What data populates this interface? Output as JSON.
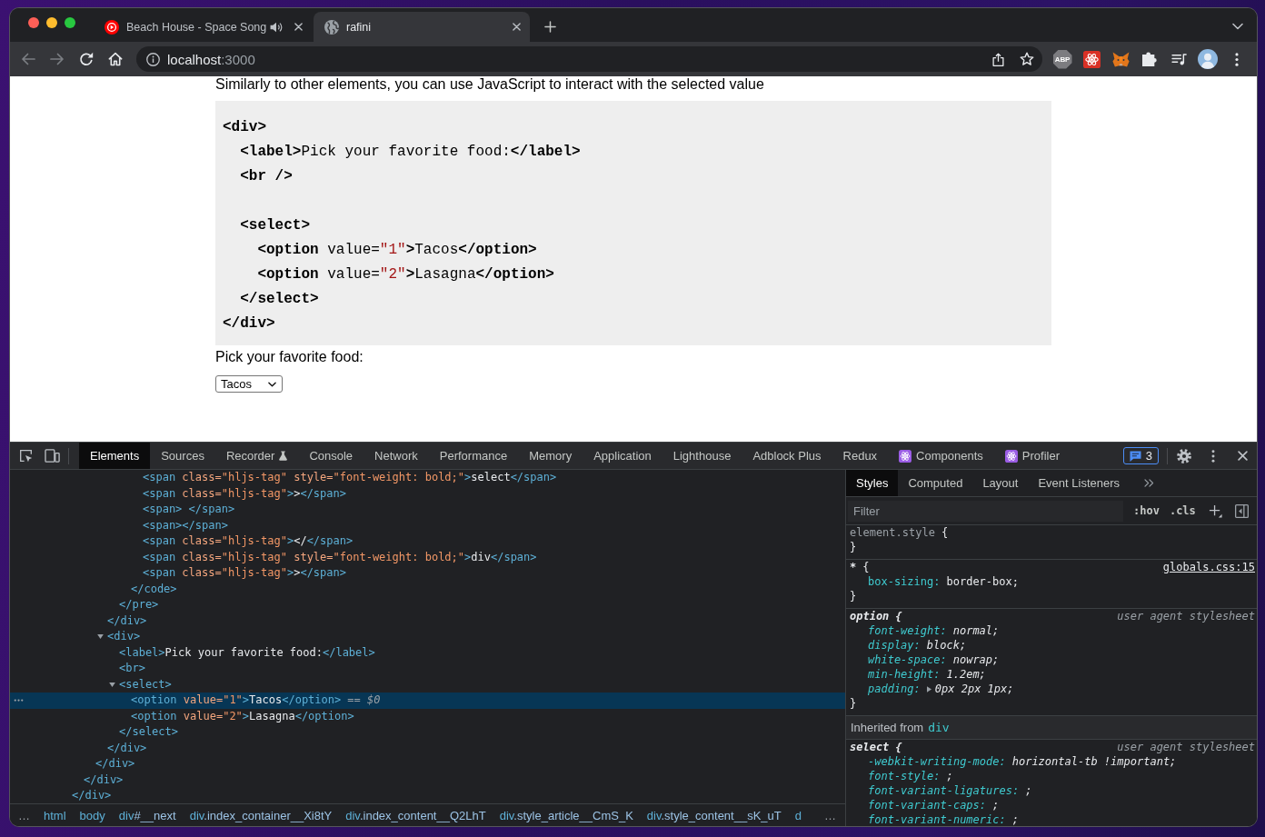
{
  "browser": {
    "tabs": [
      {
        "title": "Beach House - Space Song",
        "selected": false,
        "audio": true
      },
      {
        "title": "rafini",
        "selected": true,
        "audio": false
      }
    ],
    "toolbar": {
      "back_disabled": true,
      "forward_disabled": true,
      "host": "localhost",
      "port": ":3000",
      "extension_label": "ABP"
    }
  },
  "page": {
    "intro": "Similarly to other elements, you can use JavaScript to interact with the selected value",
    "code_lines": [
      {
        "kind": "code",
        "tokens": [
          {
            "kind": "tag",
            "text": "<div>"
          }
        ]
      },
      {
        "kind": "code",
        "tokens": [
          {
            "kind": "tag",
            "text": "  <label>"
          },
          {
            "kind": "text",
            "text": "Pick your favorite food:"
          },
          {
            "kind": "tag",
            "text": "</label>"
          }
        ]
      },
      {
        "kind": "code",
        "tokens": [
          {
            "kind": "tag",
            "text": "  <br />"
          }
        ]
      },
      {
        "kind": "blank"
      },
      {
        "kind": "code",
        "tokens": [
          {
            "kind": "tag",
            "text": "  <select>"
          }
        ]
      },
      {
        "kind": "code",
        "tokens": [
          {
            "kind": "tag",
            "text": "    <option"
          },
          {
            "kind": "attr",
            "text": " value="
          },
          {
            "kind": "string",
            "text": "\"1\""
          },
          {
            "kind": "tag",
            "text": ">"
          },
          {
            "kind": "text",
            "text": "Tacos"
          },
          {
            "kind": "tag",
            "text": "</option>"
          }
        ]
      },
      {
        "kind": "code",
        "tokens": [
          {
            "kind": "tag",
            "text": "    <option"
          },
          {
            "kind": "attr",
            "text": " value="
          },
          {
            "kind": "string",
            "text": "\"2\""
          },
          {
            "kind": "tag",
            "text": ">"
          },
          {
            "kind": "text",
            "text": "Lasagna"
          },
          {
            "kind": "tag",
            "text": "</option>"
          }
        ]
      },
      {
        "kind": "code",
        "tokens": [
          {
            "kind": "tag",
            "text": "  </select>"
          }
        ]
      },
      {
        "kind": "code",
        "tokens": [
          {
            "kind": "tag",
            "text": "</div>"
          }
        ]
      }
    ],
    "label": "Pick your favorite food:",
    "select_value": "Tacos"
  },
  "devtools": {
    "tabs": [
      {
        "label": "Elements",
        "selected": true,
        "kind": "plain"
      },
      {
        "label": "Sources",
        "selected": false,
        "kind": "plain"
      },
      {
        "label": "Recorder",
        "selected": false,
        "kind": "experimental"
      },
      {
        "label": "Console",
        "selected": false,
        "kind": "plain"
      },
      {
        "label": "Network",
        "selected": false,
        "kind": "plain"
      },
      {
        "label": "Performance",
        "selected": false,
        "kind": "plain"
      },
      {
        "label": "Memory",
        "selected": false,
        "kind": "plain"
      },
      {
        "label": "Application",
        "selected": false,
        "kind": "plain"
      },
      {
        "label": "Lighthouse",
        "selected": false,
        "kind": "plain"
      },
      {
        "label": "Adblock Plus",
        "selected": false,
        "kind": "plain"
      },
      {
        "label": "Redux",
        "selected": false,
        "kind": "plain"
      },
      {
        "label": "Components",
        "selected": false,
        "kind": "extension"
      },
      {
        "label": "Profiler",
        "selected": false,
        "kind": "extension"
      }
    ],
    "issues_count": "3",
    "elements": {
      "tree": [
        {
          "selected": false,
          "close": [
            {
              "kind": "tag",
              "text": "</div>"
            }
          ],
          "children": [
            {
              "selected": false,
              "close": [
                {
                  "kind": "tag",
                  "text": "</div>"
                }
              ],
              "children": [
                {
                  "selected": false,
                  "close": [
                    {
                      "kind": "tag",
                      "text": "</div>"
                    }
                  ],
                  "children": [
                    {
                      "selected": false,
                      "close": [
                        {
                          "kind": "tag",
                          "text": "</div>"
                        }
                      ],
                      "children": [
                        {
                          "selected": false,
                          "close": [
                            {
                              "kind": "tag",
                              "text": "</pre>"
                            }
                          ],
                          "children": [
                            {
                              "selected": false,
                              "close": [
                                {
                                  "kind": "tag",
                                  "text": "</code>"
                                }
                              ],
                              "children": [
                                {
                                  "selected": false,
                                  "open": [
                                    {
                                      "kind": "tag",
                                      "text": "<span"
                                    },
                                    {
                                      "kind": "attr",
                                      "text": " class="
                                    },
                                    {
                                      "kind": "value",
                                      "text": "\"hljs-tag\""
                                    },
                                    {
                                      "kind": "attr",
                                      "text": " style="
                                    },
                                    {
                                      "kind": "value",
                                      "text": "\"font-weight: bold;\""
                                    },
                                    {
                                      "kind": "tag",
                                      "text": ">"
                                    },
                                    {
                                      "kind": "text",
                                      "text": "select"
                                    },
                                    {
                                      "kind": "tag",
                                      "text": "</span>"
                                    }
                                  ]
                                },
                                {
                                  "selected": false,
                                  "open": [
                                    {
                                      "kind": "tag",
                                      "text": "<span"
                                    },
                                    {
                                      "kind": "attr",
                                      "text": " class="
                                    },
                                    {
                                      "kind": "value",
                                      "text": "\"hljs-tag\""
                                    },
                                    {
                                      "kind": "tag",
                                      "text": ">"
                                    },
                                    {
                                      "kind": "text",
                                      "text": ">"
                                    },
                                    {
                                      "kind": "tag",
                                      "text": "</span>"
                                    }
                                  ]
                                },
                                {
                                  "selected": false,
                                  "open": [
                                    {
                                      "kind": "tag",
                                      "text": "<span> </span>"
                                    }
                                  ]
                                },
                                {
                                  "selected": false,
                                  "open": [
                                    {
                                      "kind": "tag",
                                      "text": "<span></span>"
                                    }
                                  ]
                                },
                                {
                                  "selected": false,
                                  "open": [
                                    {
                                      "kind": "tag",
                                      "text": "<span"
                                    },
                                    {
                                      "kind": "attr",
                                      "text": " class="
                                    },
                                    {
                                      "kind": "value",
                                      "text": "\"hljs-tag\""
                                    },
                                    {
                                      "kind": "tag",
                                      "text": ">"
                                    },
                                    {
                                      "kind": "text",
                                      "text": "</"
                                    },
                                    {
                                      "kind": "tag",
                                      "text": "</span>"
                                    }
                                  ]
                                },
                                {
                                  "selected": false,
                                  "open": [
                                    {
                                      "kind": "tag",
                                      "text": "<span"
                                    },
                                    {
                                      "kind": "attr",
                                      "text": " class="
                                    },
                                    {
                                      "kind": "value",
                                      "text": "\"hljs-tag\""
                                    },
                                    {
                                      "kind": "attr",
                                      "text": " style="
                                    },
                                    {
                                      "kind": "value",
                                      "text": "\"font-weight: bold;\""
                                    },
                                    {
                                      "kind": "tag",
                                      "text": ">"
                                    },
                                    {
                                      "kind": "text",
                                      "text": "div"
                                    },
                                    {
                                      "kind": "tag",
                                      "text": "</span>"
                                    }
                                  ]
                                },
                                {
                                  "selected": false,
                                  "open": [
                                    {
                                      "kind": "tag",
                                      "text": "<span"
                                    },
                                    {
                                      "kind": "attr",
                                      "text": " class="
                                    },
                                    {
                                      "kind": "value",
                                      "text": "\"hljs-tag\""
                                    },
                                    {
                                      "kind": "tag",
                                      "text": ">"
                                    },
                                    {
                                      "kind": "text",
                                      "text": ">"
                                    },
                                    {
                                      "kind": "tag",
                                      "text": "</span>"
                                    }
                                  ]
                                }
                              ]
                            }
                          ]
                        }
                      ]
                    },
                    {
                      "selected": false,
                      "expanded": true,
                      "open": [
                        {
                          "kind": "tag",
                          "text": "<div>"
                        }
                      ],
                      "close": [
                        {
                          "kind": "tag",
                          "text": "</div>"
                        }
                      ],
                      "children": [
                        {
                          "selected": false,
                          "open": [
                            {
                              "kind": "tag",
                              "text": "<label>"
                            },
                            {
                              "kind": "text",
                              "text": "Pick your favorite food:"
                            },
                            {
                              "kind": "tag",
                              "text": "</label>"
                            }
                          ]
                        },
                        {
                          "selected": false,
                          "open": [
                            {
                              "kind": "tag",
                              "text": "<br>"
                            }
                          ]
                        },
                        {
                          "selected": false,
                          "expanded": true,
                          "open": [
                            {
                              "kind": "tag",
                              "text": "<select>"
                            }
                          ],
                          "close": [
                            {
                              "kind": "tag",
                              "text": "</select>"
                            }
                          ],
                          "children": [
                            {
                              "selected": true,
                              "hint": "== $0",
                              "open": [
                                {
                                  "kind": "tag",
                                  "text": "<option"
                                },
                                {
                                  "kind": "attr",
                                  "text": " value="
                                },
                                {
                                  "kind": "value",
                                  "text": "\"1\""
                                },
                                {
                                  "kind": "tag",
                                  "text": ">"
                                },
                                {
                                  "kind": "text",
                                  "text": "Tacos"
                                },
                                {
                                  "kind": "tag",
                                  "text": "</option>"
                                }
                              ]
                            },
                            {
                              "selected": false,
                              "open": [
                                {
                                  "kind": "tag",
                                  "text": "<option"
                                },
                                {
                                  "kind": "attr",
                                  "text": " value="
                                },
                                {
                                  "kind": "value",
                                  "text": "\"2\""
                                },
                                {
                                  "kind": "tag",
                                  "text": ">"
                                },
                                {
                                  "kind": "text",
                                  "text": "Lasagna"
                                },
                                {
                                  "kind": "tag",
                                  "text": "</option>"
                                }
                              ]
                            }
                          ]
                        }
                      ]
                    }
                  ]
                }
              ]
            }
          ]
        }
      ],
      "breadcrumbs": [
        {
          "tag": "html"
        },
        {
          "tag": "body"
        },
        {
          "tag": "div",
          "detail": "#__next"
        },
        {
          "tag": "div",
          "detail": ".index_container__Xi8tY"
        },
        {
          "tag": "div",
          "detail": ".index_content__Q2LhT"
        },
        {
          "tag": "div",
          "detail": ".style_article__CmS_K"
        },
        {
          "tag": "div",
          "detail": ".style_content__sK_uT"
        },
        {
          "tag": "d"
        }
      ],
      "overflow_left": "…",
      "overflow_right": "…"
    },
    "styles": {
      "tabs": [
        {
          "label": "Styles",
          "selected": true
        },
        {
          "label": "Computed",
          "selected": false
        },
        {
          "label": "Layout",
          "selected": false
        },
        {
          "label": "Event Listeners",
          "selected": false
        }
      ],
      "filter_placeholder": "Filter",
      "toggles": [
        ":hov",
        ".cls"
      ],
      "rules": [
        {
          "kind": "inline",
          "selector": "element.style",
          "open": "{",
          "close": "}"
        },
        {
          "kind": "author",
          "selector": "*",
          "open": "{",
          "close": "}",
          "source": "globals.css:15",
          "properties": [
            {
              "kind": "longhand",
              "name": "box-sizing:",
              "value": "border-box;"
            }
          ]
        },
        {
          "kind": "user-agent",
          "selector": "option",
          "open": "{",
          "close": "}",
          "source": "user agent stylesheet",
          "properties": [
            {
              "kind": "longhand",
              "name": "font-weight:",
              "value": "normal;"
            },
            {
              "kind": "longhand",
              "name": "display:",
              "value": "block;"
            },
            {
              "kind": "longhand",
              "name": "white-space:",
              "value": "nowrap;"
            },
            {
              "kind": "longhand",
              "name": "min-height:",
              "value": "1.2em;"
            },
            {
              "kind": "shorthand",
              "expanded": false,
              "name": "padding:",
              "value": "0px 2px 1px;"
            }
          ]
        },
        {
          "kind": "inherited",
          "label": "Inherited from",
          "element": "div"
        },
        {
          "kind": "user-agent",
          "selector": "select",
          "open": "{",
          "source": "user agent stylesheet",
          "properties": [
            {
              "kind": "longhand",
              "name": "-webkit-writing-mode:",
              "value": "horizontal-tb !important;"
            },
            {
              "kind": "longhand",
              "name": "font-style:",
              "value": ";"
            },
            {
              "kind": "longhand",
              "name": "font-variant-ligatures:",
              "value": ";"
            },
            {
              "kind": "longhand",
              "name": "font-variant-caps:",
              "value": ";"
            },
            {
              "kind": "longhand",
              "name": "font-variant-numeric:",
              "value": ";"
            }
          ]
        }
      ]
    }
  }
}
